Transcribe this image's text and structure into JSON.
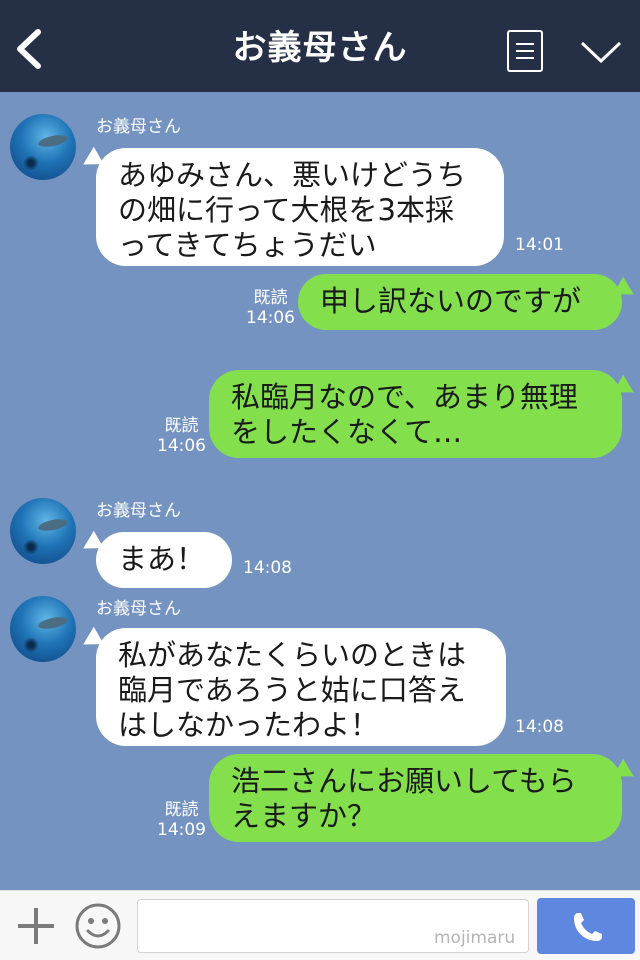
{
  "header": {
    "title": "お義母さん",
    "back_icon": "chevron-left-icon",
    "menu_icon": "menu-icon",
    "dropdown_icon": "chevron-down-icon"
  },
  "messages": [
    {
      "sender": "お義母さん",
      "direction": "in",
      "lines": [
        "あゆみさん、悪いけどうち",
        "の畑に行って大根を3本採",
        "ってきてちょうだい"
      ],
      "time": "14:01"
    },
    {
      "direction": "out",
      "lines": [
        "申し訳ないのですが"
      ],
      "read": "既読",
      "time": "14:06"
    },
    {
      "direction": "out",
      "lines": [
        "私臨月なので、あまり無理",
        "をしたくなくて…"
      ],
      "read": "既読",
      "time": "14:06"
    },
    {
      "sender": "お義母さん",
      "direction": "in",
      "lines": [
        "まあ！"
      ],
      "time": "14:08"
    },
    {
      "sender": "お義母さん",
      "direction": "in",
      "lines": [
        "私があなたくらいのときは",
        "臨月であろうと姑に口答え",
        "はしなかったわよ！"
      ],
      "time": "14:08"
    },
    {
      "direction": "out",
      "lines": [
        "浩二さんにお願いしてもら",
        "えますか？"
      ],
      "read": "既読",
      "time": "14:09"
    }
  ],
  "footer": {
    "input_value": "",
    "watermark": "mojimaru",
    "plus_icon": "plus-icon",
    "emoji_icon": "smiley-icon",
    "call_icon": "phone-icon"
  },
  "colors": {
    "header_bg": "#252f46",
    "chat_bg": "#7593c1",
    "incoming_bubble": "#ffffff",
    "outgoing_bubble": "#83e04c",
    "call_button": "#5e88df"
  }
}
